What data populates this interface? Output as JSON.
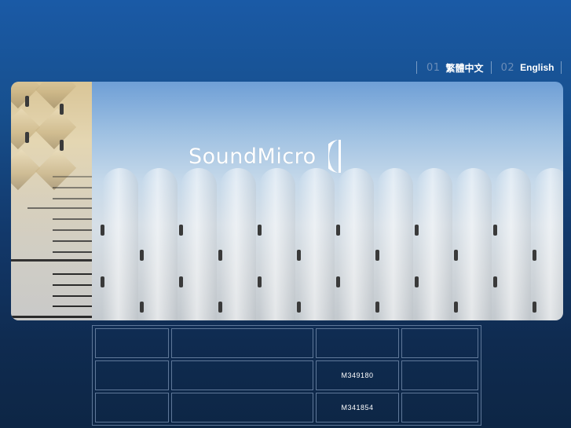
{
  "language_nav": {
    "items": [
      {
        "num": "01",
        "label": "繁體中文"
      },
      {
        "num": "02",
        "label": "English"
      }
    ]
  },
  "banner": {
    "logo_text": "SoundMicro"
  },
  "table": {
    "rows": [
      [
        "",
        "",
        "",
        ""
      ],
      [
        "",
        "",
        "M349180",
        ""
      ],
      [
        "",
        "",
        "M341854",
        ""
      ]
    ]
  },
  "colors": {
    "background_top": "#1a5aa6",
    "background_bottom": "#0d2645",
    "nav_number": "#6b8db8",
    "table_border": "#5f7899"
  }
}
